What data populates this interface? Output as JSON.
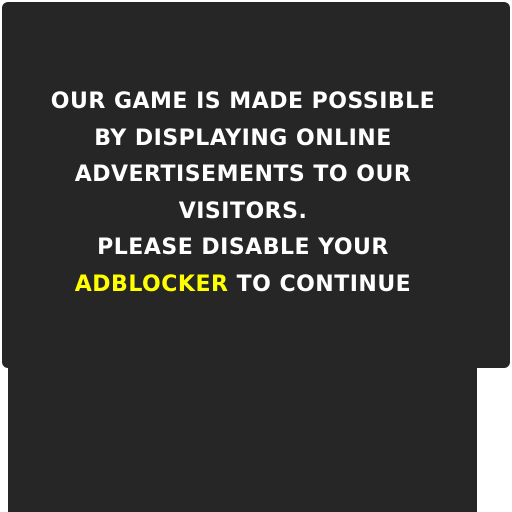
{
  "adblock_notice": {
    "lines": [
      "OUR GAME IS MADE POSSIBLE",
      "BY DISPLAYING ONLINE",
      "ADVERTISEMENTS TO OUR",
      "VISITORS.",
      "PLEASE DISABLE YOUR"
    ],
    "highlight_word": "ADBLOCKER",
    "final_suffix": " TO CONTINUE"
  },
  "colors": {
    "panel_background": "#262626",
    "text": "#ffffff",
    "highlight": "#ffff00"
  }
}
